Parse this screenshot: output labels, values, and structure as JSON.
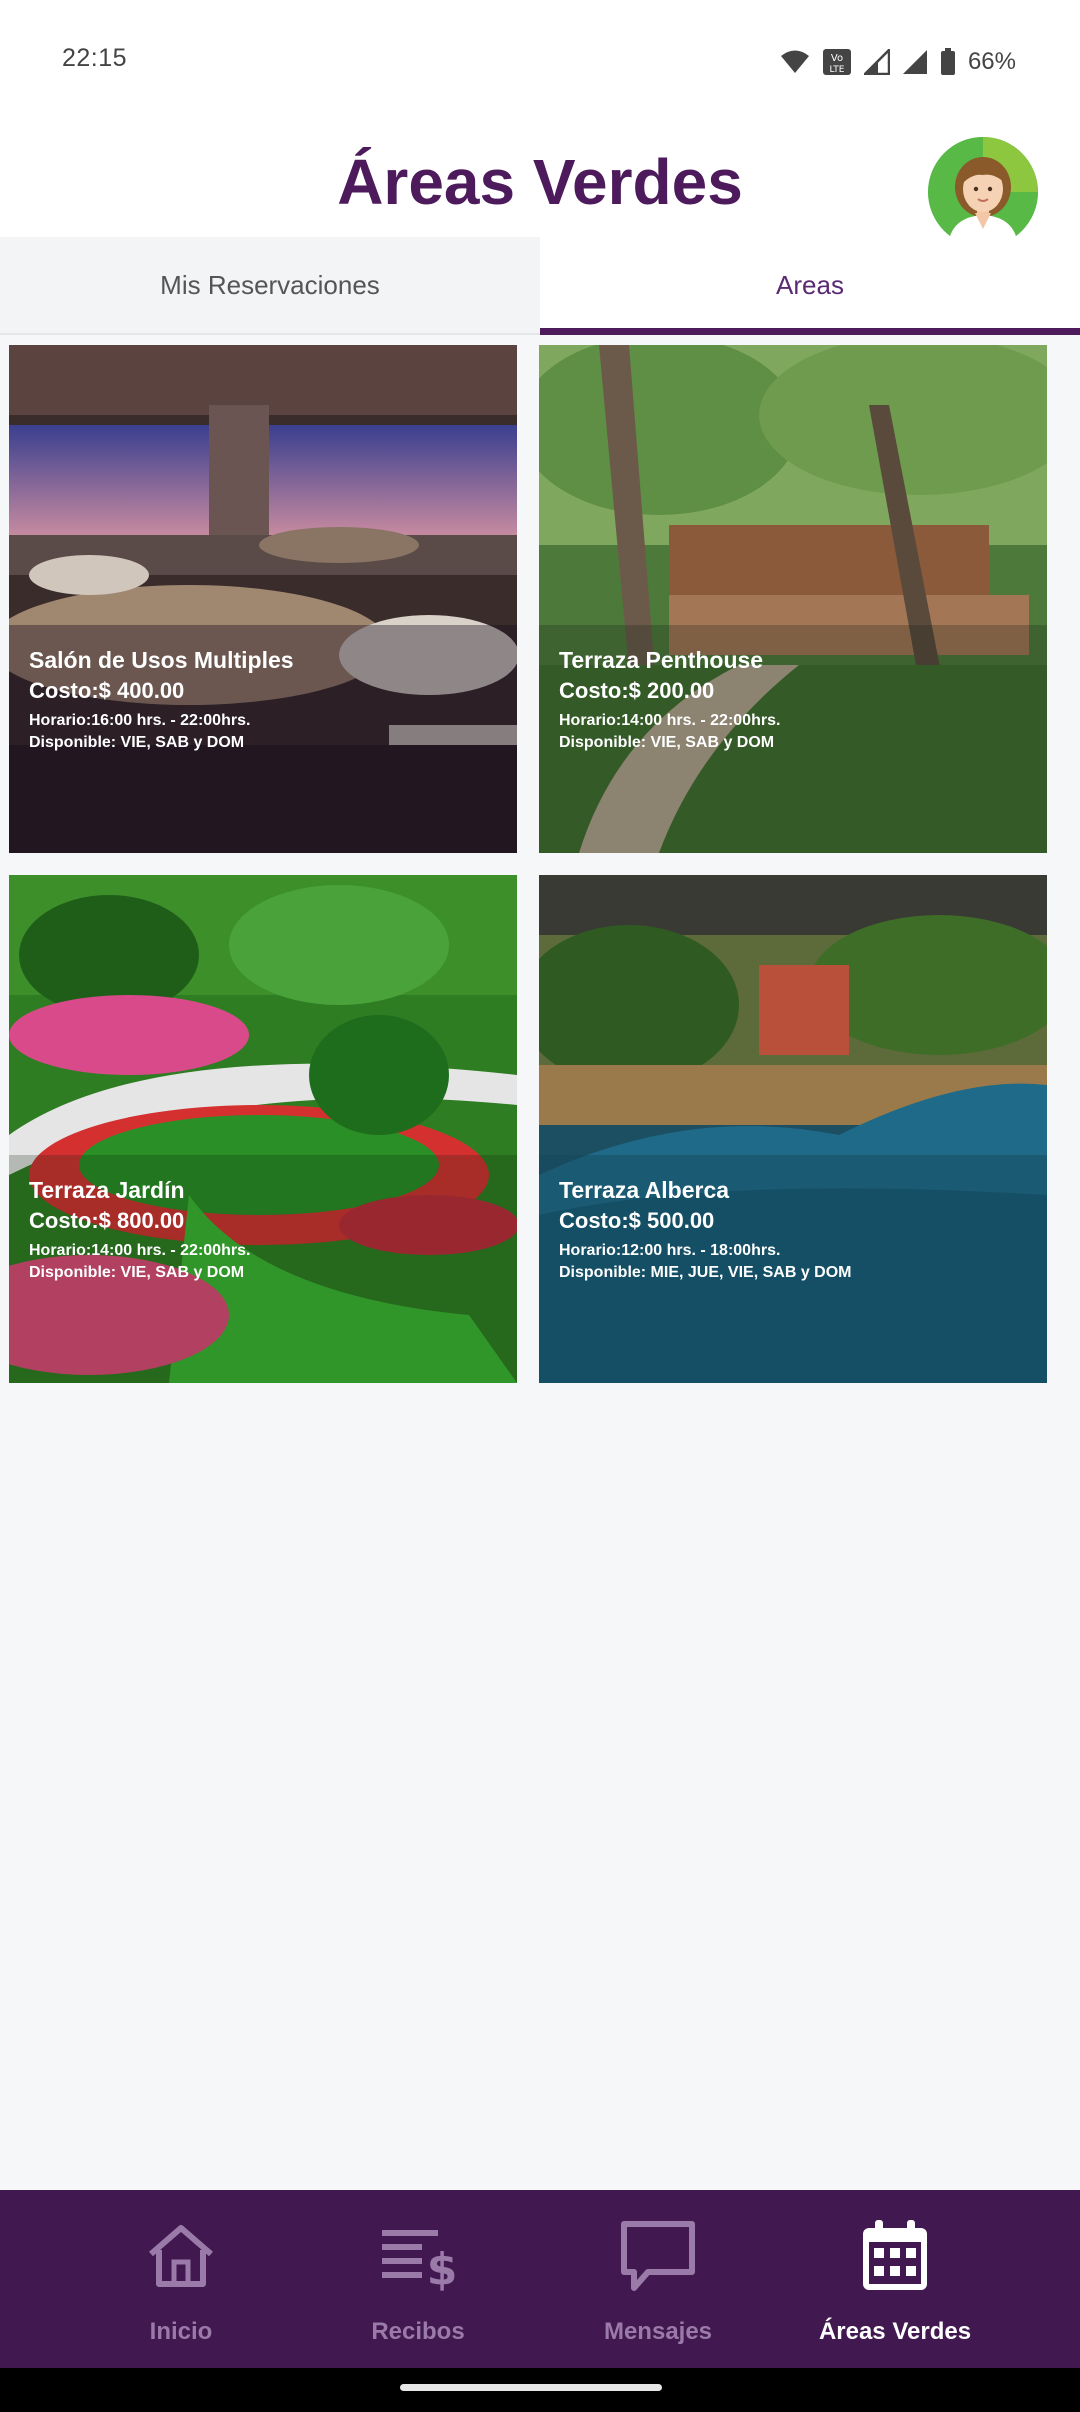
{
  "status_bar": {
    "time": "22:15",
    "battery": "66%",
    "icons": [
      "wifi-icon",
      "volte-icon",
      "signal-icon",
      "signal-icon",
      "battery-icon"
    ]
  },
  "header": {
    "title": "Áreas Verdes",
    "avatar_icon": "user-avatar-icon"
  },
  "tabs": [
    {
      "label": "Mis Reservaciones",
      "active": false
    },
    {
      "label": "Areas",
      "active": true
    }
  ],
  "areas": [
    {
      "name": "Salón de Usos Multiples",
      "cost": "Costo:$ 400.00",
      "hours": "Horario:16:00 hrs. - 22:00hrs.",
      "days": "Disponible: VIE, SAB y DOM"
    },
    {
      "name": "Terraza Penthouse",
      "cost": "Costo:$ 200.00",
      "hours": "Horario:14:00 hrs. - 22:00hrs.",
      "days": "Disponible: VIE, SAB y DOM"
    },
    {
      "name": "Terraza Jardín",
      "cost": "Costo:$ 800.00",
      "hours": "Horario:14:00 hrs. - 22:00hrs.",
      "days": "Disponible: VIE, SAB y DOM"
    },
    {
      "name": "Terraza Alberca",
      "cost": "Costo:$ 500.00",
      "hours": "Horario:12:00 hrs. - 18:00hrs.",
      "days": "Disponible: MIE, JUE, VIE, SAB y DOM"
    }
  ],
  "bottom_nav": [
    {
      "label": "Inicio",
      "icon": "home-icon",
      "active": false
    },
    {
      "label": "Recibos",
      "icon": "receipts-icon",
      "active": false
    },
    {
      "label": "Mensajes",
      "icon": "message-icon",
      "active": false
    },
    {
      "label": "Áreas Verdes",
      "icon": "calendar-icon",
      "active": true
    }
  ],
  "colors": {
    "brand": "#4d1a5c",
    "nav_background": "#41184f",
    "nav_inactive": "#9a7aa8",
    "nav_active": "#ffffff"
  }
}
